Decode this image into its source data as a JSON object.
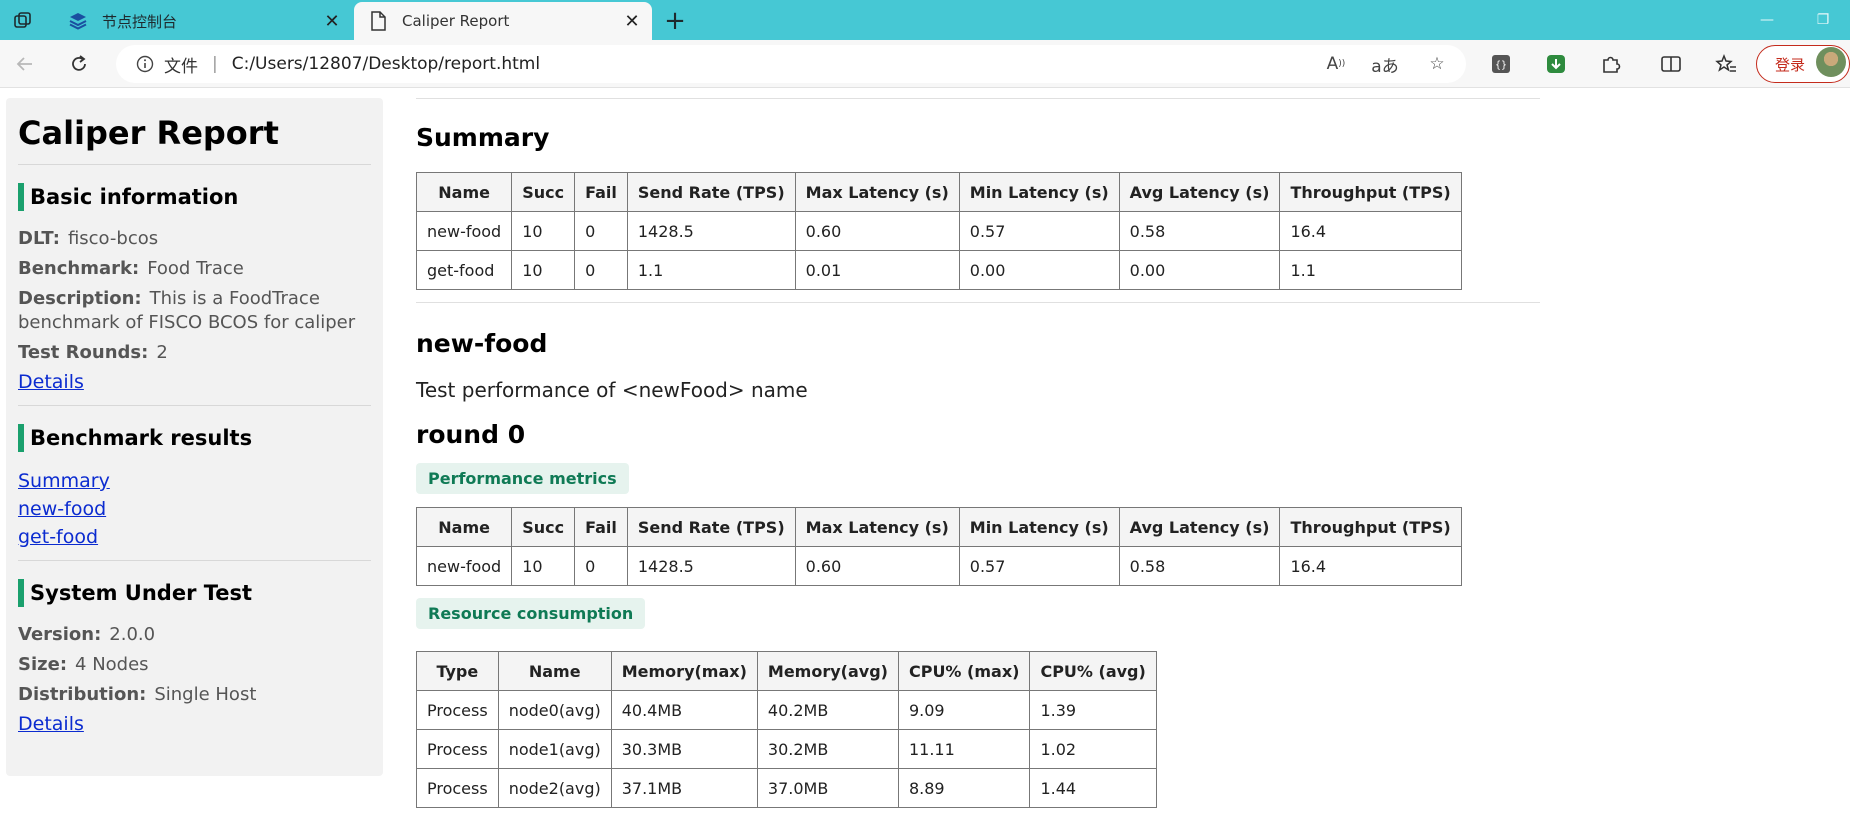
{
  "browser": {
    "tabs": [
      {
        "label": "节点控制台",
        "active": false
      },
      {
        "label": "Caliper Report",
        "active": true
      }
    ],
    "address": {
      "file_label": "文件",
      "url": "C:/Users/12807/Desktop/report.html"
    },
    "login_label": "登录",
    "accent_color": "#46c8d4"
  },
  "sidebar": {
    "title": "Caliper Report",
    "basic": {
      "heading": "Basic information",
      "dlt_label": "DLT:",
      "dlt_value": "fisco-bcos",
      "benchmark_label": "Benchmark:",
      "benchmark_value": "Food Trace",
      "description_label": "Description:",
      "description_value": "This is a FoodTrace benchmark of FISCO BCOS for caliper",
      "rounds_label": "Test Rounds:",
      "rounds_value": "2",
      "details_link": "Details"
    },
    "results": {
      "heading": "Benchmark results",
      "links": [
        "Summary",
        "new-food",
        "get-food"
      ]
    },
    "sut": {
      "heading": "System Under Test",
      "version_label": "Version:",
      "version_value": "2.0.0",
      "size_label": "Size:",
      "size_value": "4 Nodes",
      "distribution_label": "Distribution:",
      "distribution_value": "Single Host",
      "details_link": "Details"
    }
  },
  "main": {
    "summary": {
      "heading": "Summary",
      "columns": [
        "Name",
        "Succ",
        "Fail",
        "Send Rate (TPS)",
        "Max Latency (s)",
        "Min Latency (s)",
        "Avg Latency (s)",
        "Throughput (TPS)"
      ],
      "rows": [
        [
          "new-food",
          "10",
          "0",
          "1428.5",
          "0.60",
          "0.57",
          "0.58",
          "16.4"
        ],
        [
          "get-food",
          "10",
          "0",
          "1.1",
          "0.01",
          "0.00",
          "0.00",
          "1.1"
        ]
      ]
    },
    "newfood": {
      "heading": "new-food",
      "description": "Test performance of <newFood> name",
      "round_heading": "round 0",
      "perf_badge": "Performance metrics",
      "perf_columns": [
        "Name",
        "Succ",
        "Fail",
        "Send Rate (TPS)",
        "Max Latency (s)",
        "Min Latency (s)",
        "Avg Latency (s)",
        "Throughput (TPS)"
      ],
      "perf_rows": [
        [
          "new-food",
          "10",
          "0",
          "1428.5",
          "0.60",
          "0.57",
          "0.58",
          "16.4"
        ]
      ],
      "resource_badge": "Resource consumption",
      "resource_columns": [
        "Type",
        "Name",
        "Memory(max)",
        "Memory(avg)",
        "CPU% (max)",
        "CPU% (avg)"
      ],
      "resource_rows": [
        [
          "Process",
          "node0(avg)",
          "40.4MB",
          "40.2MB",
          "9.09",
          "1.39"
        ],
        [
          "Process",
          "node1(avg)",
          "30.3MB",
          "30.2MB",
          "11.11",
          "1.02"
        ],
        [
          "Process",
          "node2(avg)",
          "37.1MB",
          "37.0MB",
          "8.89",
          "1.44"
        ]
      ]
    }
  }
}
